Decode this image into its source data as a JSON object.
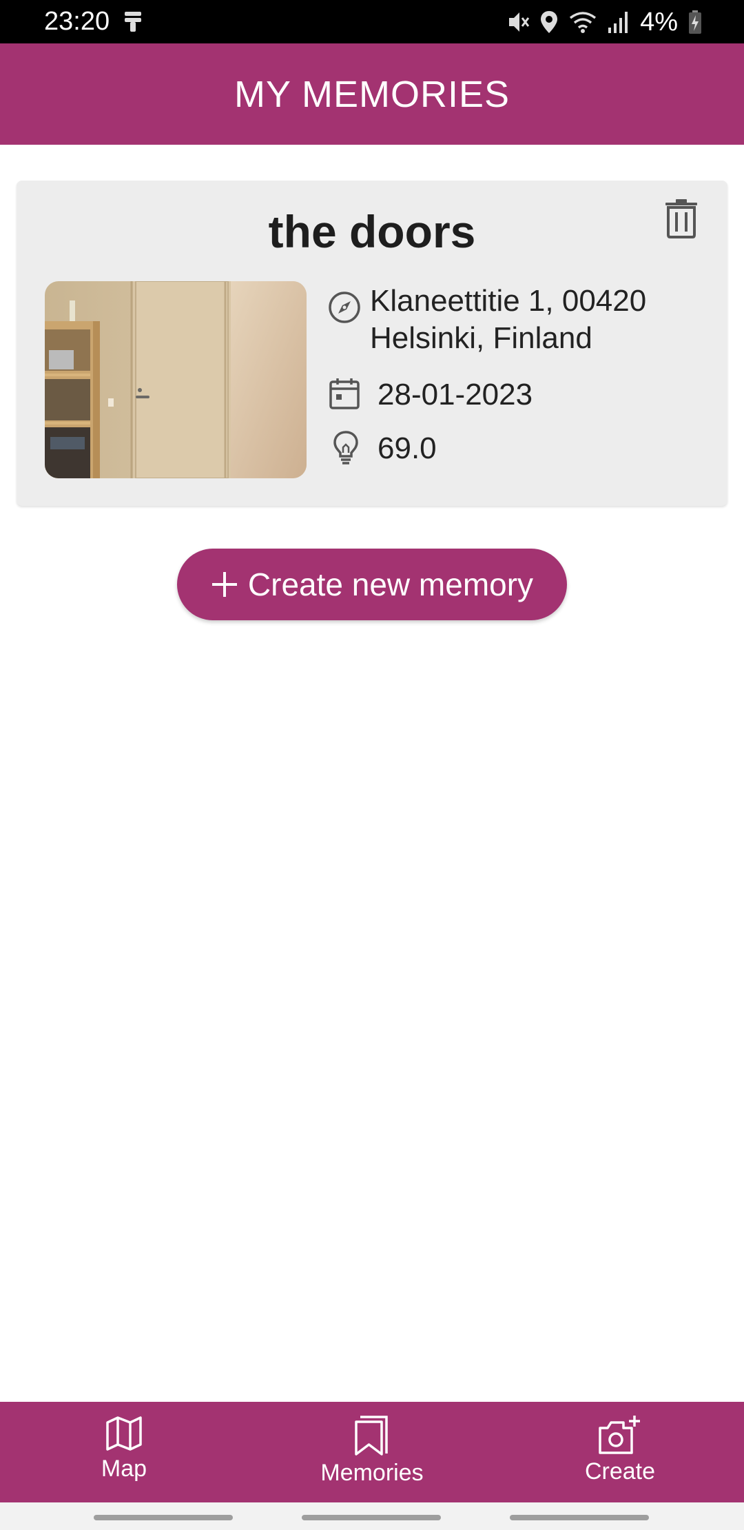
{
  "status_bar": {
    "time": "23:20",
    "battery": "4%",
    "icons": [
      "notification-icon",
      "mute-icon",
      "location-icon",
      "wifi-icon",
      "signal-icon",
      "battery-charging-icon"
    ]
  },
  "app_bar": {
    "title": "MY MEMORIES"
  },
  "memories": [
    {
      "title": "the doors",
      "address_line1": "Klaneettitie 1, 00420",
      "address_line2": "Helsinki, Finland",
      "date": "28-01-2023",
      "value": "69.0",
      "icons": {
        "location": "compass-icon",
        "date": "calendar-icon",
        "value": "lightbulb-icon",
        "delete": "trash-icon"
      }
    }
  ],
  "create_button": {
    "label": "Create new memory",
    "icon": "plus-icon"
  },
  "bottom_nav": [
    {
      "label": "Map",
      "icon": "map-icon"
    },
    {
      "label": "Memories",
      "icon": "bookmark-icon"
    },
    {
      "label": "Create",
      "icon": "camera-add-icon"
    }
  ],
  "colors": {
    "primary": "#a33371",
    "card_bg": "#ededed",
    "status_bar": "#000000"
  }
}
